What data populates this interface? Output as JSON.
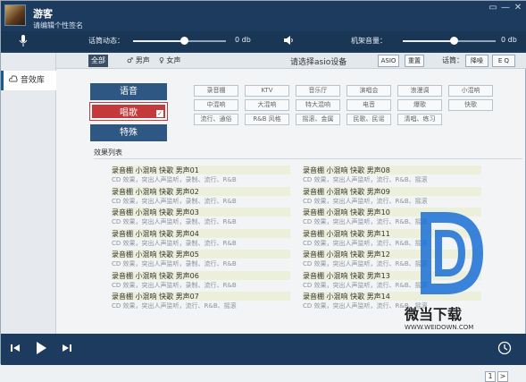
{
  "header": {
    "name": "游客",
    "signature": "请编辑个性签名",
    "window_buttons": [
      "▭",
      "—",
      "✕"
    ]
  },
  "controls": {
    "mic_label": "话筒动态：",
    "mic_value": "0 db",
    "mic_level": 0.55,
    "speaker_label": "机架音量：",
    "speaker_value": "0 db",
    "speaker_level": 0.55
  },
  "sidebar": {
    "items": [
      {
        "label": "音效库"
      }
    ]
  },
  "filter_tabs": [
    {
      "label": "全部",
      "active": true
    },
    {
      "label": "男声",
      "active": false
    },
    {
      "label": "女声",
      "active": false
    }
  ],
  "device": {
    "label": "请选择asio设备",
    "asio": "ASIO",
    "reset": "重置",
    "mic_label": "话筒：",
    "noise": "降噪",
    "eq": "E Q"
  },
  "categories": [
    {
      "label": "语音",
      "selected": false
    },
    {
      "label": "唱歌",
      "selected": true
    },
    {
      "label": "特殊",
      "selected": false
    }
  ],
  "tags": [
    [
      "录音棚",
      "KTV",
      "音乐厅",
      "演唱会",
      "浪漫调",
      "小混响"
    ],
    [
      "中混响",
      "大混响",
      "特大混响",
      "电音",
      "爆歌",
      "快歌"
    ],
    [
      "流行、通俗",
      "R&B 风格",
      "摇滚、金属",
      "民歌、民谣",
      "清唱、练习"
    ]
  ],
  "effects": {
    "title": "效果列表",
    "left": [
      {
        "title": "录音棚 小混响 快歌 男声01",
        "desc": "CD 效果，突出人声监听，录制、流行、R&B"
      },
      {
        "title": "录音棚 小混响 快歌 男声02",
        "desc": "CD 效果，突出人声监听，录制、流行、R&B"
      },
      {
        "title": "录音棚 小混响 快歌 男声03",
        "desc": "CD 效果，突出人声监听，录制、流行、R&B"
      },
      {
        "title": "录音棚 小混响 快歌 男声04",
        "desc": "CD 效果，突出人声监听，录制、流行、R&B"
      },
      {
        "title": "录音棚 小混响 快歌 男声05",
        "desc": "CD 效果，突出人声监听，录制、流行、R&B"
      },
      {
        "title": "录音棚 小混响 快歌 男声06",
        "desc": "CD 效果，突出人声监听，录制、流行、R&B"
      },
      {
        "title": "录音棚 小混响 快歌 男声07",
        "desc": "CD 效果，突出人声监听，流行、R&B、摇滚"
      }
    ],
    "right": [
      {
        "title": "录音棚 小混响 快歌 男声08",
        "desc": "CD 效果，突出人声监听，流行、R&B、摇滚"
      },
      {
        "title": "录音棚 小混响 快歌 男声09",
        "desc": "CD 效果，突出人声监听，流行、R&B、摇滚"
      },
      {
        "title": "录音棚 小混响 快歌 男声10",
        "desc": "CD 效果，突出人声监听，流行、R&B、摇滚"
      },
      {
        "title": "录音棚 小混响 快歌 男声11",
        "desc": "CD 效果，突出人声监听，流行、R&B、摇滚"
      },
      {
        "title": "录音棚 小混响 快歌 男声12",
        "desc": "CD 效果，突出人声监听，流行、R&B、摇滚"
      },
      {
        "title": "录音棚 小混响 快歌 男声13",
        "desc": "CD 效果，突出人声监听，流行、R&B、摇滚"
      },
      {
        "title": "录音棚 小混响 快歌 男声14",
        "desc": "CD 效果，突出人声监听，流行、R&B、摇滚"
      }
    ]
  },
  "pagination": {
    "current": "1",
    "next": ">"
  },
  "watermark": {
    "text": "微当下载",
    "url": "WWW.WEIDOWN.COM"
  },
  "colors": {
    "header": "#1c3b5e",
    "selected_category": "#c43a3a",
    "category": "#2e5883"
  }
}
